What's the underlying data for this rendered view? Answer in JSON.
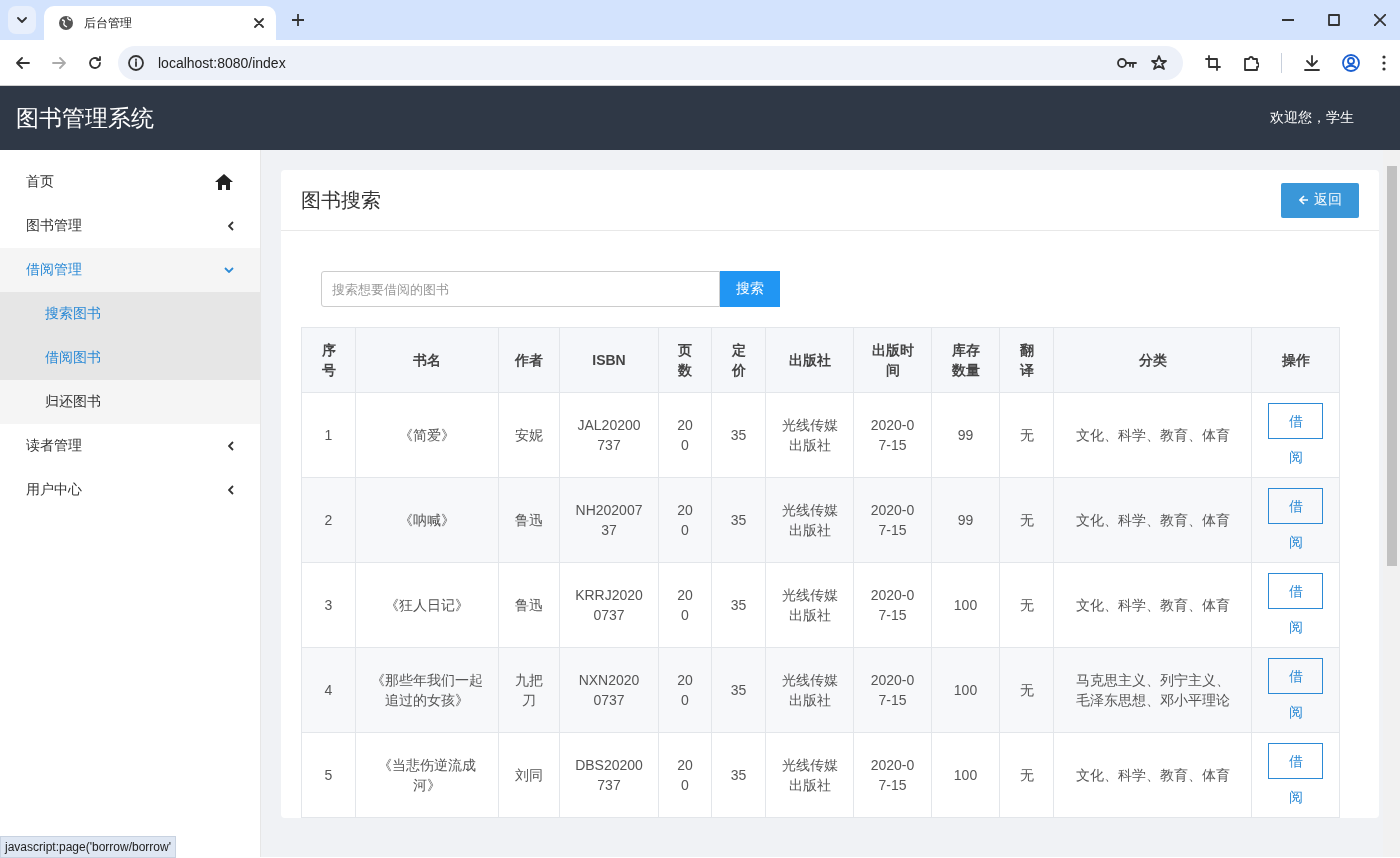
{
  "browser": {
    "tabs": [
      {
        "title": "后台管理",
        "selected": true
      }
    ],
    "url": "localhost:8080/index"
  },
  "app": {
    "title": "图书管理系统",
    "welcome": "欢迎您，学生"
  },
  "sidebar": {
    "items": [
      {
        "label": "首页",
        "kind": "home",
        "selected": false
      },
      {
        "label": "图书管理",
        "kind": "menu",
        "expanded": false,
        "selected": false
      },
      {
        "label": "借阅管理",
        "kind": "menu",
        "expanded": true,
        "selected": true,
        "children": [
          {
            "label": "搜索图书",
            "selected": true
          },
          {
            "label": "借阅图书",
            "selected": true
          },
          {
            "label": "归还图书",
            "selected": false
          }
        ]
      },
      {
        "label": "读者管理",
        "kind": "menu",
        "expanded": false,
        "selected": false
      },
      {
        "label": "用户中心",
        "kind": "menu",
        "expanded": false,
        "selected": false
      }
    ]
  },
  "card": {
    "title": "图书搜索",
    "back_button": "返回",
    "search": {
      "placeholder": "搜索想要借阅的图书",
      "button": "搜索"
    },
    "table": {
      "columns": [
        "序号",
        "书名",
        "作者",
        "ISBN",
        "页数",
        "定价",
        "出版社",
        "出版时间",
        "库存数量",
        "翻译",
        "分类",
        "操作"
      ],
      "rows": [
        {
          "cells": [
            "1",
            "《简爱》",
            "安妮",
            "JAL20200737",
            "200",
            "35",
            "光线传媒出版社",
            "2020-07-15",
            "99",
            "无",
            "文化、科学、教育、体育"
          ],
          "action": "借阅"
        },
        {
          "cells": [
            "2",
            "《呐喊》",
            "鲁迅",
            "NH20200737",
            "200",
            "35",
            "光线传媒出版社",
            "2020-07-15",
            "99",
            "无",
            "文化、科学、教育、体育"
          ],
          "action": "借阅"
        },
        {
          "cells": [
            "3",
            "《狂人日记》",
            "鲁迅",
            "KRRJ20200737",
            "200",
            "35",
            "光线传媒出版社",
            "2020-07-15",
            "100",
            "无",
            "文化、科学、教育、体育"
          ],
          "action": "借阅"
        },
        {
          "cells": [
            "4",
            "《那些年我们一起追过的女孩》",
            "九把刀",
            "NXN20200737",
            "200",
            "35",
            "光线传媒出版社",
            "2020-07-15",
            "100",
            "无",
            "马克思主义、列宁主义、毛泽东思想、邓小平理论"
          ],
          "action": "借阅"
        },
        {
          "cells": [
            "5",
            "《当悲伤逆流成河》",
            "刘同",
            "DBS20200737",
            "200",
            "35",
            "光线传媒出版社",
            "2020-07-15",
            "100",
            "无",
            "文化、科学、教育、体育"
          ],
          "action": "借阅"
        }
      ]
    }
  },
  "status_url": "javascript:page('borrow/borrow'"
}
